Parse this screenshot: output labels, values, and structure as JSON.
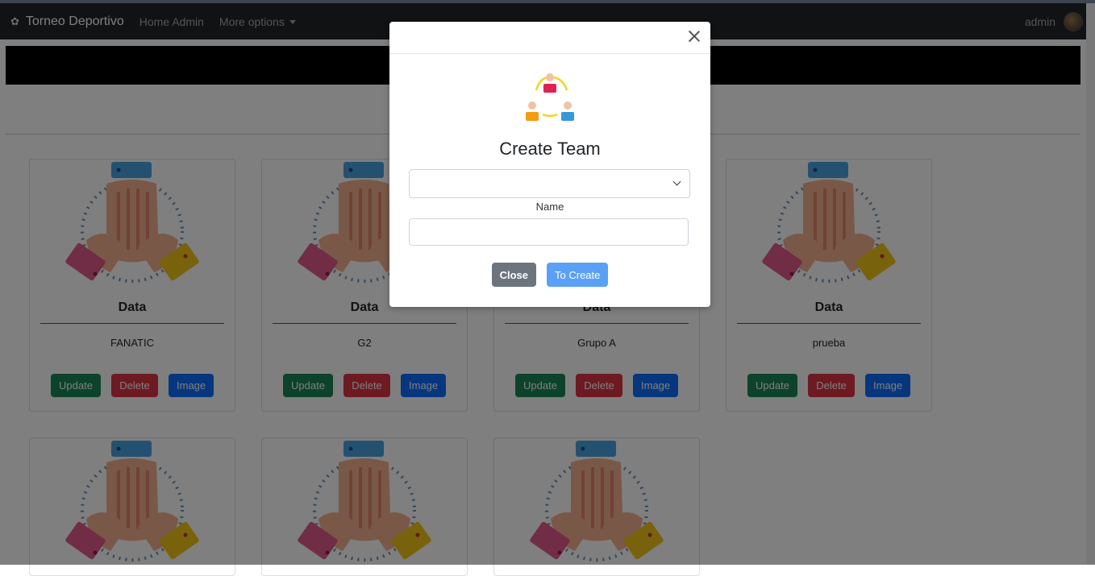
{
  "navbar": {
    "brand": "Torneo Deportivo",
    "brand_icon": "flower-icon",
    "links": [
      "Home Admin",
      "More options"
    ],
    "user": "admin"
  },
  "cards": [
    {
      "title": "Data",
      "name": "FANATIC"
    },
    {
      "title": "Data",
      "name": "G2"
    },
    {
      "title": "Data",
      "name": "Grupo A"
    },
    {
      "title": "Data",
      "name": "prueba"
    },
    {
      "title": "",
      "name": ""
    },
    {
      "title": "",
      "name": ""
    },
    {
      "title": "",
      "name": ""
    }
  ],
  "card_buttons": {
    "update": "Update",
    "delete": "Delete",
    "image": "Image"
  },
  "modal": {
    "title": "Create Team",
    "select_value": "",
    "name_label": "Name",
    "name_value": "",
    "close_label": "Close",
    "create_label": "To Create"
  },
  "colors": {
    "navbar": "#212529",
    "success": "#198754",
    "danger": "#dc3545",
    "primary": "#0d6efd",
    "secondary": "#6c757d"
  }
}
